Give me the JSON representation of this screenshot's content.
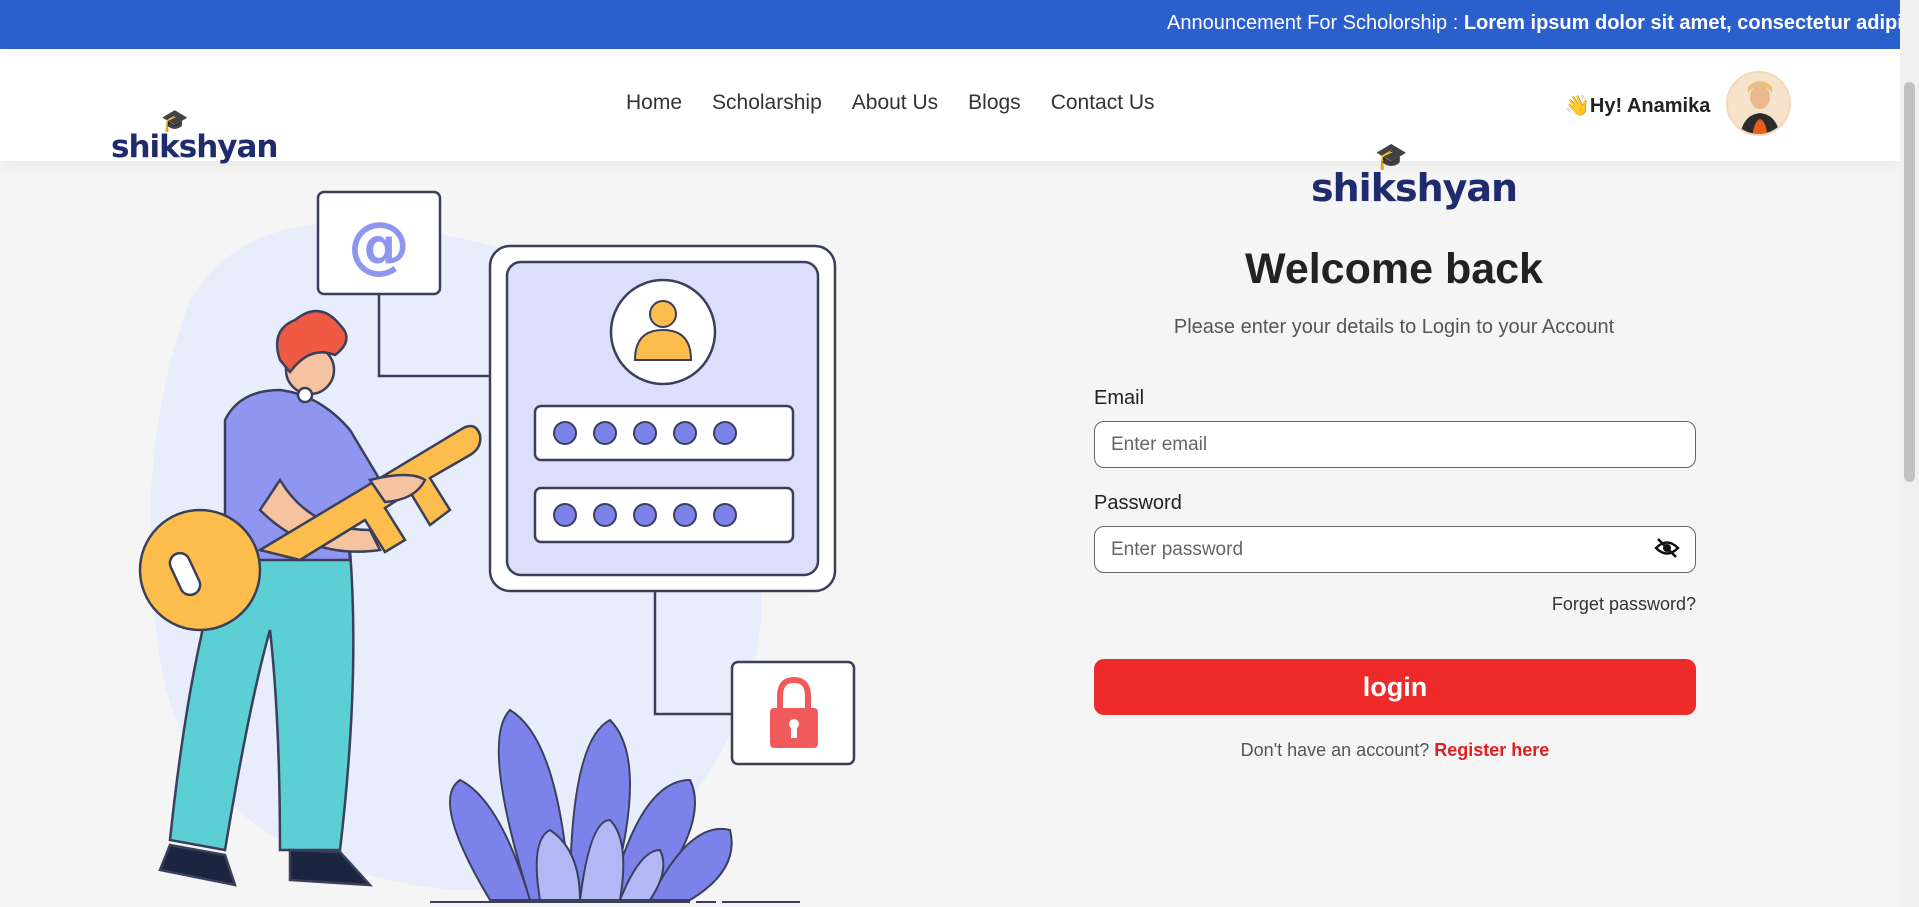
{
  "announcement": {
    "label": "Announcement For Scholorship :",
    "message": "Lorem ipsum dolor sit amet, consectetur adipiscing elit"
  },
  "brand": {
    "logo_text": "shikshyan"
  },
  "nav": {
    "links": [
      "Home",
      "Scholarship",
      "About Us",
      "Blogs",
      "Contact Us"
    ],
    "greeting": "👋Hy! Anamika"
  },
  "login": {
    "title": "Welcome back",
    "subtitle": "Please enter your details to Login to your Account",
    "email_label": "Email",
    "email_placeholder": "Enter email",
    "password_label": "Password",
    "password_placeholder": "Enter password",
    "forget_label": "Forget password?",
    "button_label": "login",
    "register_prompt": "Don't have an account?",
    "register_link": "Register here"
  },
  "colors": {
    "announcement_bg": "#2b5fcc",
    "primary_button": "#ef2a2a",
    "brand_navy": "#1f2b6c",
    "brand_orange": "#e8611b",
    "illustration_purple": "#7b83eb",
    "illustration_yellow": "#fdbd4c",
    "illustration_teal": "#5ccfd4"
  },
  "icons": {
    "eye": "eye-slash-icon",
    "at": "at-sign-icon",
    "lock": "padlock-icon",
    "user": "user-icon"
  }
}
